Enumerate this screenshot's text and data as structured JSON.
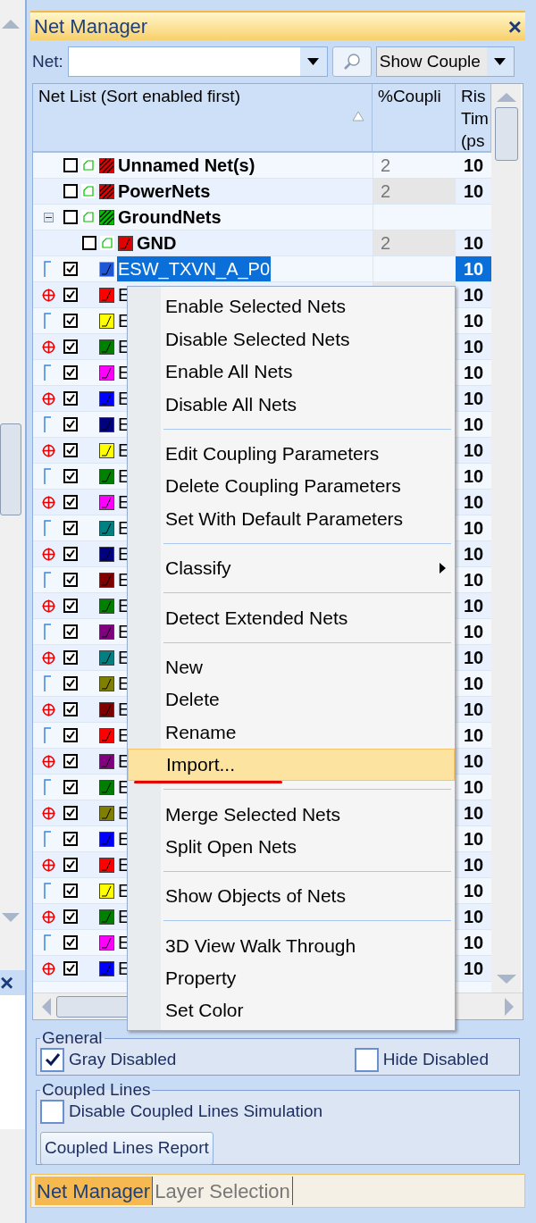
{
  "panel": {
    "title": "Net Manager",
    "close": "×"
  },
  "net_filter": {
    "label": "Net:",
    "view_value": "Show Couple"
  },
  "table": {
    "columns": [
      {
        "label": "Net List (Sort enabled first)",
        "sorted": true
      },
      {
        "label": "%Coupli",
        "sorted": false
      },
      {
        "label": "Ris\nTim\n(ps",
        "sorted": false
      }
    ],
    "rows": [
      {
        "kind": "group",
        "name": "Unnamed Net(s)",
        "enabled": false,
        "color": "#e00000",
        "coupling": "2",
        "rise": "10",
        "selected": false
      },
      {
        "kind": "group",
        "name": "PowerNets",
        "enabled": false,
        "color": "#e00000",
        "coupling": "2",
        "rise": "10",
        "selected": false
      },
      {
        "kind": "group",
        "name": "GroundNets",
        "enabled": false,
        "color": "#00c000",
        "selected": false,
        "expanded": true,
        "children": [
          {
            "kind": "member",
            "name": "GND",
            "enabled": false,
            "color": "#e00000",
            "coupling": "2",
            "rise": "10",
            "selected": false
          }
        ]
      },
      {
        "kind": "pair_start",
        "name": "ESW_TXVN_A_P0",
        "enabled": true,
        "color": "#1e56d8",
        "rise": "10",
        "selected": true
      },
      {
        "kind": "pair_end",
        "name": "E",
        "enabled": true,
        "color": "#ff0000",
        "rise": "10",
        "selected": false
      },
      {
        "kind": "pair_start",
        "name": "E",
        "enabled": true,
        "color": "#ffff00",
        "rise": "10",
        "selected": false
      },
      {
        "kind": "pair_end",
        "name": "E",
        "enabled": true,
        "color": "#008000",
        "rise": "10",
        "selected": false
      },
      {
        "kind": "pair_start",
        "name": "E",
        "enabled": true,
        "color": "#ff00ff",
        "rise": "10",
        "selected": false
      },
      {
        "kind": "pair_end",
        "name": "E",
        "enabled": true,
        "color": "#0000ff",
        "rise": "10",
        "selected": false
      },
      {
        "kind": "pair_start",
        "name": "E",
        "enabled": true,
        "color": "#000080",
        "rise": "10",
        "selected": false
      },
      {
        "kind": "pair_end",
        "name": "E",
        "enabled": true,
        "color": "#ffff00",
        "rise": "10",
        "selected": false
      },
      {
        "kind": "pair_start",
        "name": "E",
        "enabled": true,
        "color": "#008000",
        "rise": "10",
        "selected": false
      },
      {
        "kind": "pair_end",
        "name": "E",
        "enabled": true,
        "color": "#ff00ff",
        "rise": "10",
        "selected": false
      },
      {
        "kind": "pair_start",
        "name": "E",
        "enabled": true,
        "color": "#008080",
        "rise": "10",
        "selected": false
      },
      {
        "kind": "pair_end",
        "name": "E",
        "enabled": true,
        "color": "#000080",
        "rise": "10",
        "selected": false
      },
      {
        "kind": "pair_start",
        "name": "E",
        "enabled": true,
        "color": "#800000",
        "rise": "10",
        "selected": false
      },
      {
        "kind": "pair_end",
        "name": "E",
        "enabled": true,
        "color": "#008000",
        "rise": "10",
        "selected": false
      },
      {
        "kind": "pair_start",
        "name": "E",
        "enabled": true,
        "color": "#800080",
        "rise": "10",
        "selected": false
      },
      {
        "kind": "pair_end",
        "name": "E",
        "enabled": true,
        "color": "#008080",
        "rise": "10",
        "selected": false
      },
      {
        "kind": "pair_start",
        "name": "E",
        "enabled": true,
        "color": "#808000",
        "rise": "10",
        "selected": false
      },
      {
        "kind": "pair_end",
        "name": "E",
        "enabled": true,
        "color": "#800000",
        "rise": "10",
        "selected": false
      },
      {
        "kind": "pair_start",
        "name": "E",
        "enabled": true,
        "color": "#ff0000",
        "rise": "10",
        "selected": false
      },
      {
        "kind": "pair_end",
        "name": "E",
        "enabled": true,
        "color": "#800080",
        "rise": "10",
        "selected": false
      },
      {
        "kind": "pair_start",
        "name": "E",
        "enabled": true,
        "color": "#008000",
        "rise": "10",
        "selected": false
      },
      {
        "kind": "pair_end",
        "name": "E",
        "enabled": true,
        "color": "#808000",
        "rise": "10",
        "selected": false
      },
      {
        "kind": "pair_start",
        "name": "E",
        "enabled": true,
        "color": "#0000ff",
        "rise": "10",
        "selected": false
      },
      {
        "kind": "pair_end",
        "name": "E",
        "enabled": true,
        "color": "#ff0000",
        "rise": "10",
        "selected": false
      },
      {
        "kind": "pair_start",
        "name": "E",
        "enabled": true,
        "color": "#ffff00",
        "rise": "10",
        "selected": false
      },
      {
        "kind": "pair_end",
        "name": "E",
        "enabled": true,
        "color": "#008000",
        "rise": "10",
        "selected": false
      },
      {
        "kind": "pair_start",
        "name": "E",
        "enabled": true,
        "color": "#ff00ff",
        "rise": "10",
        "selected": false
      },
      {
        "kind": "pair_end",
        "name": "E",
        "enabled": true,
        "color": "#0000ff",
        "rise": "10",
        "selected": false
      }
    ]
  },
  "context_menu": {
    "items": [
      {
        "kind": "item",
        "label": "Enable Selected Nets",
        "selected": false
      },
      {
        "kind": "item",
        "label": "Disable Selected Nets",
        "selected": false
      },
      {
        "kind": "item",
        "label": "Enable All Nets",
        "selected": false
      },
      {
        "kind": "item",
        "label": "Disable All Nets",
        "selected": false
      },
      {
        "kind": "separator"
      },
      {
        "kind": "item",
        "label": "Edit Coupling Parameters",
        "selected": false
      },
      {
        "kind": "item",
        "label": "Delete Coupling Parameters",
        "selected": false
      },
      {
        "kind": "item",
        "label": "Set With Default Parameters",
        "selected": false
      },
      {
        "kind": "separator"
      },
      {
        "kind": "submenu",
        "label": "Classify",
        "selected": false
      },
      {
        "kind": "separator"
      },
      {
        "kind": "item",
        "label": "Detect Extended Nets",
        "selected": false
      },
      {
        "kind": "separator"
      },
      {
        "kind": "item",
        "label": "New",
        "selected": false
      },
      {
        "kind": "item",
        "label": "Delete",
        "selected": false
      },
      {
        "kind": "item",
        "label": "Rename",
        "selected": false
      },
      {
        "kind": "item",
        "label": "Import...",
        "selected": true
      },
      {
        "kind": "separator"
      },
      {
        "kind": "item",
        "label": "Merge Selected Nets",
        "selected": false
      },
      {
        "kind": "item",
        "label": "Split Open Nets",
        "selected": false
      },
      {
        "kind": "separator"
      },
      {
        "kind": "item",
        "label": "Show Objects of Nets",
        "selected": false
      },
      {
        "kind": "separator"
      },
      {
        "kind": "item",
        "label": "3D View Walk Through",
        "selected": false
      },
      {
        "kind": "item",
        "label": "Property",
        "selected": false
      },
      {
        "kind": "item",
        "label": "Set Color",
        "selected": false
      }
    ]
  },
  "general": {
    "title": "General",
    "options": [
      {
        "label": "Gray Disabled",
        "checked": true
      },
      {
        "label": "Hide Disabled",
        "checked": false
      }
    ]
  },
  "coupled_lines": {
    "title": "Coupled Lines",
    "option": {
      "label": "Disable Coupled Lines Simulation",
      "checked": false
    },
    "button": "Coupled Lines Report"
  },
  "bottom_tabs": [
    {
      "label": "Net Manager",
      "selected": true
    },
    {
      "label": "Layer Selection",
      "selected": false
    }
  ],
  "side_panel": {
    "close": "×"
  }
}
